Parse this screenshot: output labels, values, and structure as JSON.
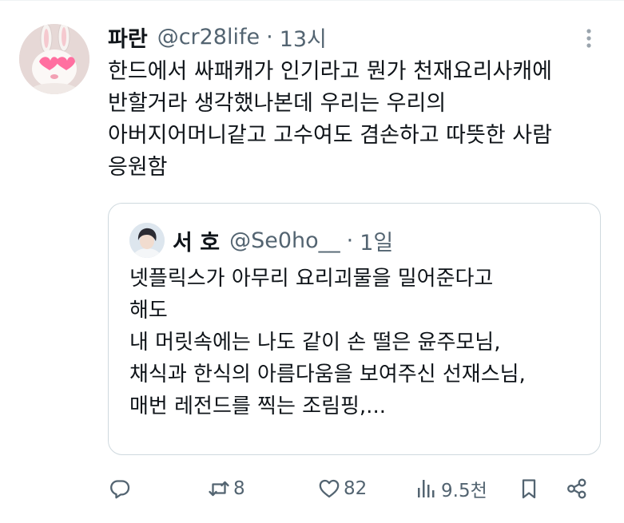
{
  "tweet": {
    "display_name": "파란",
    "handle": "@cr28life",
    "separator": "·",
    "time": "13시",
    "text_lines": [
      "한드에서 싸패캐가 인기라고 뭔가 천재요리사캐에",
      "반할거라 생각했나본데 우리는 우리의",
      "아버지어머니같고 고수여도 겸손하고 따뜻한 사람",
      "응원함"
    ]
  },
  "quote": {
    "display_name": "서 호",
    "handle": "@Se0ho__",
    "separator": "·",
    "time": "1일",
    "text_lines": [
      "넷플릭스가 아무리 요리괴물을 밀어준다고",
      "해도",
      "내 머릿속에는 나도 같이 손 떨은 윤주모님,",
      "채식과 한식의 아름다움을 보여주신 선재스님,",
      "매번 레전드를 찍는 조림핑,..."
    ]
  },
  "actions": {
    "reply": {
      "icon": "reply-icon",
      "count": ""
    },
    "retweet": {
      "icon": "retweet-icon",
      "count": "8"
    },
    "like": {
      "icon": "heart-icon",
      "count": "82"
    },
    "views": {
      "icon": "views-icon",
      "count": "9.5천"
    },
    "bookmark": {
      "icon": "bookmark-icon"
    },
    "share": {
      "icon": "share-icon"
    }
  },
  "colors": {
    "text": "#0f1419",
    "secondary": "#536471",
    "border": "#cfd9de",
    "avatar_accent": "#ff6fa0"
  }
}
